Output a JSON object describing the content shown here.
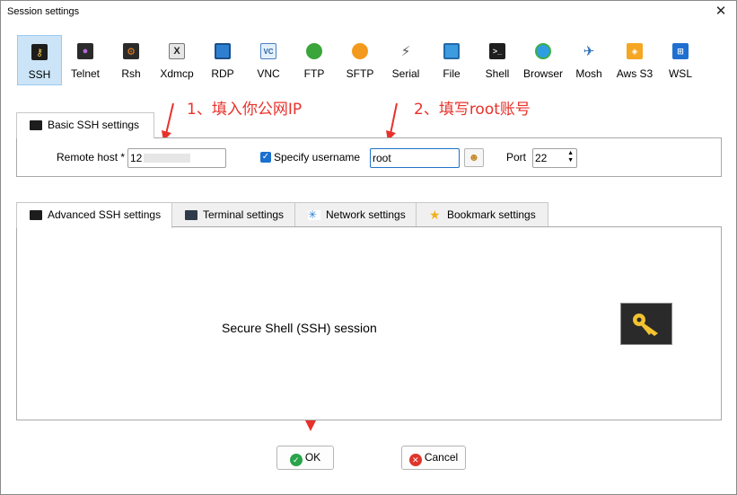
{
  "window": {
    "title": "Session settings"
  },
  "session_types": [
    {
      "label": "SSH",
      "icon": "ssh-key-icon",
      "selected": true
    },
    {
      "label": "Telnet",
      "icon": "telnet-icon"
    },
    {
      "label": "Rsh",
      "icon": "rsh-icon"
    },
    {
      "label": "Xdmcp",
      "icon": "xdmcp-icon"
    },
    {
      "label": "RDP",
      "icon": "rdp-monitor-icon"
    },
    {
      "label": "VNC",
      "icon": "vnc-icon"
    },
    {
      "label": "FTP",
      "icon": "ftp-globe-icon"
    },
    {
      "label": "SFTP",
      "icon": "sftp-globe-icon"
    },
    {
      "label": "Serial",
      "icon": "serial-plug-icon"
    },
    {
      "label": "File",
      "icon": "file-monitor-icon"
    },
    {
      "label": "Shell",
      "icon": "shell-terminal-icon"
    },
    {
      "label": "Browser",
      "icon": "browser-globe-icon"
    },
    {
      "label": "Mosh",
      "icon": "mosh-satellite-icon"
    },
    {
      "label": "Aws S3",
      "icon": "aws-s3-icon"
    },
    {
      "label": "WSL",
      "icon": "wsl-windows-icon"
    }
  ],
  "annotations": {
    "step1": "1、填入你公网IP",
    "step2": "2、填写root账号"
  },
  "basic_tab": {
    "label": "Basic SSH settings"
  },
  "basic": {
    "remote_host_label": "Remote host *",
    "remote_host_value": "12",
    "specify_username_label": "Specify username",
    "specify_username_checked": true,
    "username_value": "root",
    "port_label": "Port",
    "port_value": "22"
  },
  "lower_tabs": [
    {
      "label": "Advanced SSH settings",
      "icon": "ssh-key-icon"
    },
    {
      "label": "Terminal settings",
      "icon": "terminal-icon"
    },
    {
      "label": "Network settings",
      "icon": "network-icon"
    },
    {
      "label": "Bookmark settings",
      "icon": "star-icon"
    }
  ],
  "lower_panel": {
    "description": "Secure Shell (SSH) session"
  },
  "buttons": {
    "ok": "OK",
    "cancel": "Cancel"
  },
  "colors": {
    "annotation": "#e8312a",
    "selection": "#cce4f7",
    "ok_icon": "#2aa44a",
    "cancel_icon": "#e0352b"
  }
}
